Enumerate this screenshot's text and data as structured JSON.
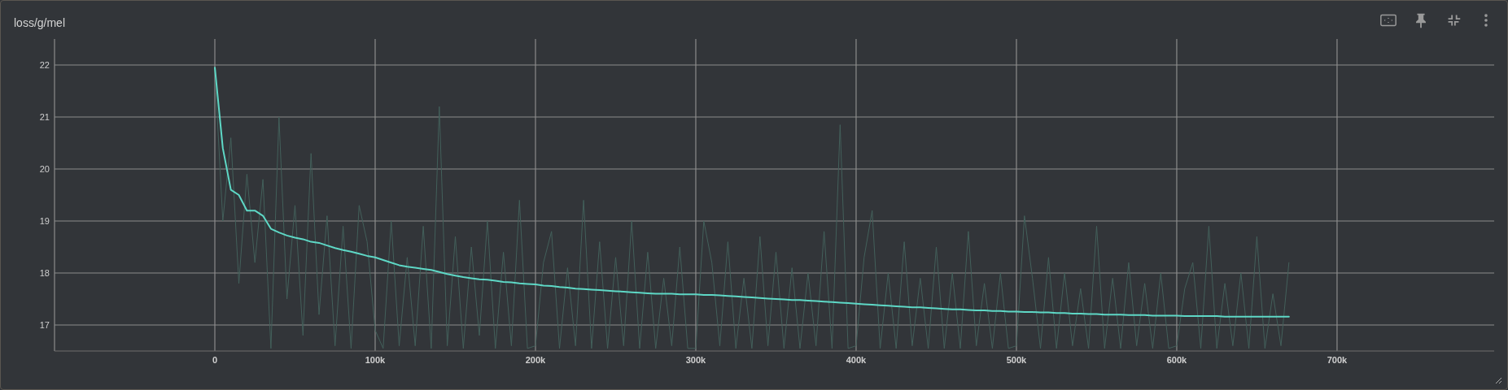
{
  "title": "loss/g/mel",
  "toolbar": [
    {
      "kind": "fit"
    },
    {
      "kind": "pin"
    },
    {
      "kind": "collapse"
    },
    {
      "kind": "more"
    }
  ],
  "chart_data": {
    "type": "line",
    "x": [
      0,
      5000,
      10000,
      15000,
      20000,
      25000,
      30000,
      35000,
      40000,
      45000,
      50000,
      55000,
      60000,
      65000,
      70000,
      75000,
      80000,
      85000,
      90000,
      95000,
      100000,
      105000,
      110000,
      115000,
      120000,
      125000,
      130000,
      135000,
      140000,
      145000,
      150000,
      155000,
      160000,
      165000,
      170000,
      175000,
      180000,
      185000,
      190000,
      195000,
      200000,
      205000,
      210000,
      215000,
      220000,
      225000,
      230000,
      235000,
      240000,
      245000,
      250000,
      255000,
      260000,
      265000,
      270000,
      275000,
      280000,
      285000,
      290000,
      295000,
      300000,
      305000,
      310000,
      315000,
      320000,
      325000,
      330000,
      335000,
      340000,
      345000,
      350000,
      355000,
      360000,
      365000,
      370000,
      375000,
      380000,
      385000,
      390000,
      395000,
      400000,
      405000,
      410000,
      415000,
      420000,
      425000,
      430000,
      435000,
      440000,
      445000,
      450000,
      455000,
      460000,
      465000,
      470000,
      475000,
      480000,
      485000,
      490000,
      495000,
      500000,
      505000,
      510000,
      515000,
      520000,
      525000,
      530000,
      535000,
      540000,
      545000,
      550000,
      555000,
      560000,
      565000,
      570000,
      575000,
      580000,
      585000,
      590000,
      595000,
      600000,
      605000,
      610000,
      615000,
      620000,
      625000,
      630000,
      635000,
      640000,
      645000,
      650000,
      655000,
      660000,
      665000,
      670000
    ],
    "series": [
      {
        "color": "#43605b",
        "values": [
          21.9,
          19.0,
          20.6,
          17.8,
          19.9,
          18.2,
          19.8,
          16.55,
          21.0,
          17.5,
          19.3,
          16.8,
          20.3,
          17.2,
          19.1,
          16.6,
          18.9,
          16.55,
          19.3,
          18.6,
          16.9,
          16.55,
          19.0,
          16.6,
          18.3,
          16.6,
          18.9,
          16.55,
          21.2,
          16.6,
          18.7,
          16.55,
          18.5,
          16.8,
          19.0,
          16.55,
          18.4,
          16.6,
          19.4,
          16.55,
          16.6,
          18.2,
          18.8,
          16.55,
          18.1,
          16.6,
          19.4,
          16.55,
          18.6,
          16.55,
          18.3,
          16.6,
          19.0,
          16.55,
          18.4,
          16.55,
          17.9,
          16.6,
          18.5,
          16.55,
          16.55,
          19.0,
          18.2,
          16.6,
          18.6,
          16.55,
          17.9,
          16.55,
          18.7,
          16.6,
          18.4,
          16.55,
          18.1,
          16.55,
          18.0,
          16.6,
          18.8,
          16.55,
          20.85,
          16.55,
          16.6,
          18.3,
          19.2,
          16.55,
          18.0,
          16.55,
          18.6,
          16.6,
          17.9,
          16.55,
          18.5,
          16.55,
          18.0,
          16.55,
          18.8,
          16.6,
          17.8,
          16.55,
          18.0,
          16.55,
          16.6,
          19.1,
          17.9,
          16.55,
          18.3,
          16.55,
          18.0,
          16.6,
          17.7,
          16.55,
          18.9,
          16.55,
          17.9,
          16.55,
          18.2,
          16.6,
          17.8,
          16.55,
          18.0,
          16.55,
          16.6,
          17.7,
          18.2,
          16.55,
          18.9,
          16.55,
          17.8,
          16.6,
          18.0,
          16.55,
          18.7,
          16.55,
          17.6,
          16.6,
          18.2
        ]
      },
      {
        "color": "#5ed8c6",
        "values": [
          21.95,
          20.4,
          19.6,
          19.5,
          19.2,
          19.2,
          19.1,
          18.85,
          18.78,
          18.72,
          18.68,
          18.65,
          18.6,
          18.58,
          18.53,
          18.48,
          18.44,
          18.41,
          18.37,
          18.33,
          18.3,
          18.25,
          18.2,
          18.15,
          18.12,
          18.1,
          18.08,
          18.06,
          18.02,
          17.98,
          17.95,
          17.92,
          17.9,
          17.88,
          17.87,
          17.85,
          17.83,
          17.82,
          17.8,
          17.79,
          17.78,
          17.76,
          17.75,
          17.73,
          17.72,
          17.7,
          17.69,
          17.68,
          17.67,
          17.66,
          17.65,
          17.64,
          17.63,
          17.62,
          17.61,
          17.6,
          17.6,
          17.6,
          17.59,
          17.59,
          17.59,
          17.58,
          17.58,
          17.57,
          17.56,
          17.55,
          17.54,
          17.53,
          17.52,
          17.51,
          17.5,
          17.49,
          17.48,
          17.48,
          17.47,
          17.46,
          17.45,
          17.44,
          17.43,
          17.42,
          17.41,
          17.4,
          17.39,
          17.38,
          17.37,
          17.36,
          17.35,
          17.34,
          17.34,
          17.33,
          17.32,
          17.31,
          17.3,
          17.3,
          17.29,
          17.28,
          17.28,
          17.27,
          17.27,
          17.26,
          17.26,
          17.25,
          17.25,
          17.24,
          17.24,
          17.23,
          17.23,
          17.22,
          17.22,
          17.21,
          17.21,
          17.2,
          17.2,
          17.2,
          17.19,
          17.19,
          17.19,
          17.18,
          17.18,
          17.18,
          17.18,
          17.17,
          17.17,
          17.17,
          17.17,
          17.17,
          17.16,
          17.16,
          17.16,
          17.16,
          17.16,
          17.16,
          17.16,
          17.16,
          17.16
        ]
      }
    ],
    "xlim": [
      -100000,
      798000
    ],
    "ylim": [
      16.5,
      22.5
    ],
    "xticks": [
      {
        "value": 0,
        "label": "0"
      },
      {
        "value": 100000,
        "label": "100k"
      },
      {
        "value": 200000,
        "label": "200k"
      },
      {
        "value": 300000,
        "label": "300k"
      },
      {
        "value": 400000,
        "label": "400k"
      },
      {
        "value": 500000,
        "label": "500k"
      },
      {
        "value": 600000,
        "label": "600k"
      },
      {
        "value": 700000,
        "label": "700k"
      }
    ],
    "yticks": [
      17,
      18,
      19,
      20,
      21,
      22
    ],
    "grid": true
  }
}
